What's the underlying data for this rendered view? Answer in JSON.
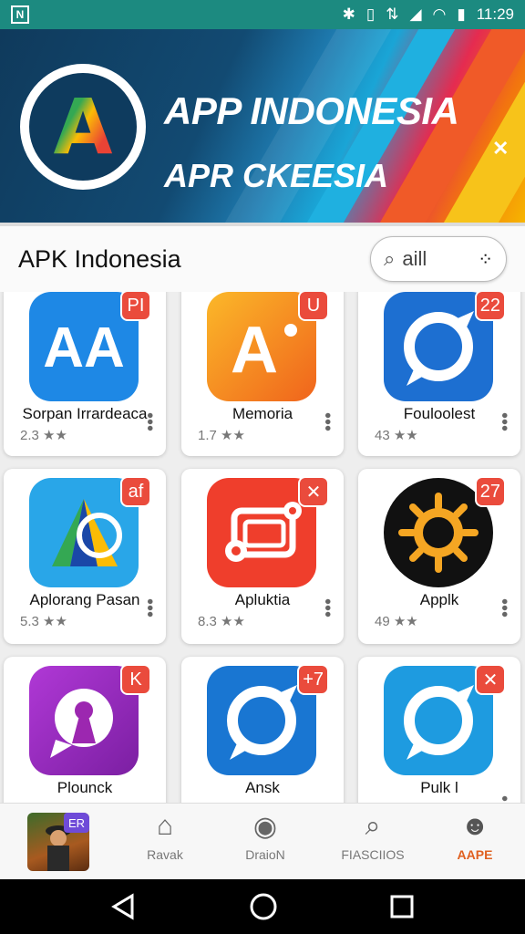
{
  "status_bar": {
    "time": "11:29"
  },
  "banner": {
    "logo_letter": "A",
    "title_line1": "APP INDONESIA",
    "title_line2": "APR CKEESIA"
  },
  "header": {
    "title": "APK Indonesia",
    "search_value": "aill"
  },
  "apps": [
    {
      "name": "Sorpan Irrardeaca",
      "rating": "2.3 ★★",
      "badge": "PI",
      "icon": "aa-icon",
      "bg": "#1e88e5"
    },
    {
      "name": "Memoria",
      "rating": "1.7 ★★",
      "badge": "U",
      "icon": "a-plus-icon",
      "bg": "#f59e0b"
    },
    {
      "name": "Fouloolest",
      "rating": "43 ★★",
      "badge": "22",
      "icon": "chat-bubble-icon",
      "bg": "#1d6fd1"
    },
    {
      "name": "Aplorang Pasan",
      "rating": "5.3 ★★",
      "badge": "af",
      "icon": "a-triangle-icon",
      "bg": "#29a6e8"
    },
    {
      "name": "Apluktia",
      "rating": "8.3 ★★",
      "badge": "✕",
      "icon": "gear-window-icon",
      "bg": "#ef3e2c"
    },
    {
      "name": "Applk",
      "rating": "49 ★★",
      "badge": "27",
      "icon": "sun-gear-icon",
      "bg": "#111111"
    },
    {
      "name": "Plounck",
      "rating": "",
      "badge": "K",
      "icon": "keyhole-chat-icon",
      "bg": "#9c27b0"
    },
    {
      "name": "Ansk",
      "rating": "",
      "badge": "+7",
      "icon": "chat-bubble-icon",
      "bg": "#1976d2"
    },
    {
      "name": "Pulk l",
      "rating": "",
      "badge": "✕",
      "icon": "chat-bubble-icon",
      "bg": "#1e9be0"
    }
  ],
  "bottom_nav": {
    "avatar_badge": "ER",
    "items": [
      {
        "label": "Ravak",
        "icon": "home-icon"
      },
      {
        "label": "DraioN",
        "icon": "compass-icon"
      },
      {
        "label": "FIASCIIOS",
        "icon": "search-icon"
      },
      {
        "label": "AAPE",
        "icon": "profile-icon"
      }
    ]
  }
}
